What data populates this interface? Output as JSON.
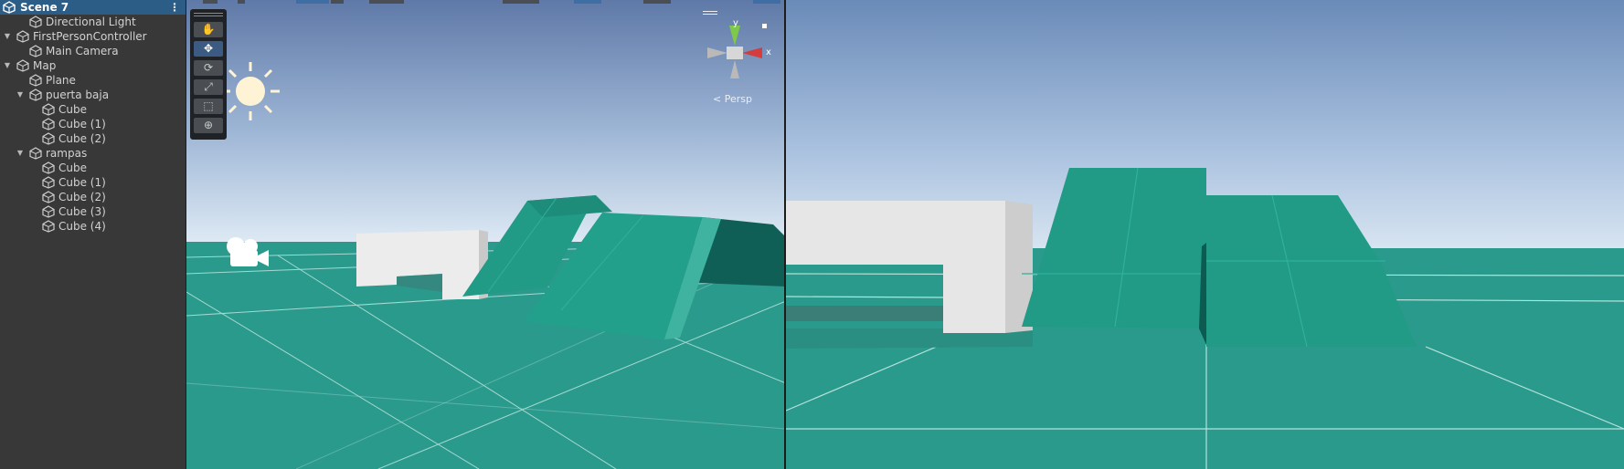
{
  "hierarchy": {
    "scene_label": "Scene 7",
    "menu_icon": "kebab-menu-icon",
    "items": [
      {
        "label": "Directional Light",
        "depth": 1,
        "foldout": false
      },
      {
        "label": "FirstPersonController",
        "depth": 0,
        "foldout": true
      },
      {
        "label": "Main Camera",
        "depth": 1,
        "foldout": false
      },
      {
        "label": "Map",
        "depth": 0,
        "foldout": true
      },
      {
        "label": "Plane",
        "depth": 1,
        "foldout": false
      },
      {
        "label": "puerta baja",
        "depth": 1,
        "foldout": true
      },
      {
        "label": "Cube",
        "depth": 2,
        "foldout": false
      },
      {
        "label": "Cube (1)",
        "depth": 2,
        "foldout": false
      },
      {
        "label": "Cube (2)",
        "depth": 2,
        "foldout": false
      },
      {
        "label": "rampas",
        "depth": 1,
        "foldout": true
      },
      {
        "label": "Cube",
        "depth": 2,
        "foldout": false
      },
      {
        "label": "Cube (1)",
        "depth": 2,
        "foldout": false
      },
      {
        "label": "Cube (2)",
        "depth": 2,
        "foldout": false
      },
      {
        "label": "Cube (3)",
        "depth": 2,
        "foldout": false
      },
      {
        "label": "Cube (4)",
        "depth": 2,
        "foldout": false
      }
    ]
  },
  "scene_view": {
    "tools": [
      {
        "name": "hand-tool",
        "icon": "hand-icon",
        "glyph": "✋",
        "active": false
      },
      {
        "name": "move-tool",
        "icon": "move-arrows-icon",
        "glyph": "✥",
        "active": true
      },
      {
        "name": "rotate-tool",
        "icon": "rotate-icon",
        "glyph": "⟳",
        "active": false
      },
      {
        "name": "scale-tool",
        "icon": "scale-icon",
        "glyph": "⤢",
        "active": false
      },
      {
        "name": "rect-tool",
        "icon": "rect-tool-icon",
        "glyph": "⬚",
        "active": false
      },
      {
        "name": "transform-tool",
        "icon": "transform-icon",
        "glyph": "⊕",
        "active": false
      }
    ],
    "gizmo": {
      "y_label": "y",
      "x_label": "x",
      "projection": "Persp"
    },
    "colors": {
      "sky_top": "#5f79a8",
      "sky_horizon": "#d4e3f1",
      "ground": "#2a9a8c",
      "ramp": "#219a86",
      "wall": "#e9e9e9"
    }
  },
  "game_view": {
    "colors": {
      "sky_top": "#6a8bb8",
      "sky_horizon": "#cfdded",
      "ground": "#2a9a8c",
      "ramp": "#219a86",
      "wall": "#e2e2e2"
    }
  }
}
